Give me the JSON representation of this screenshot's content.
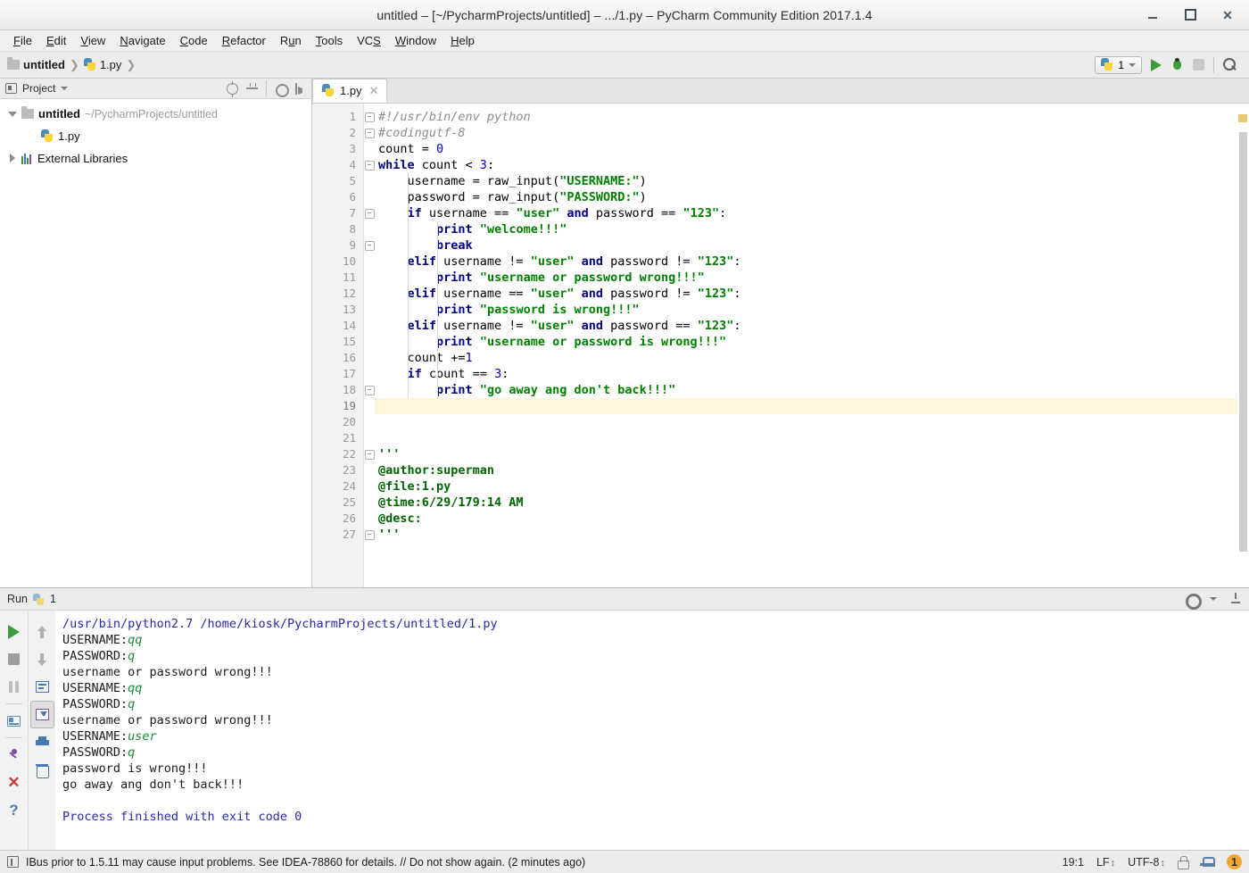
{
  "window": {
    "title": "untitled – [~/PycharmProjects/untitled] – .../1.py – PyCharm Community Edition 2017.1.4",
    "minimize_label": "",
    "maximize_label": "",
    "close_label": "✕"
  },
  "menubar": [
    {
      "pre": "",
      "mn": "F",
      "post": "ile"
    },
    {
      "pre": "",
      "mn": "E",
      "post": "dit"
    },
    {
      "pre": "",
      "mn": "V",
      "post": "iew"
    },
    {
      "pre": "",
      "mn": "N",
      "post": "avigate"
    },
    {
      "pre": "",
      "mn": "C",
      "post": "ode"
    },
    {
      "pre": "",
      "mn": "R",
      "post": "efactor"
    },
    {
      "pre": "R",
      "mn": "u",
      "post": "n"
    },
    {
      "pre": "",
      "mn": "T",
      "post": "ools"
    },
    {
      "pre": "VC",
      "mn": "S",
      "post": ""
    },
    {
      "pre": "",
      "mn": "W",
      "post": "indow"
    },
    {
      "pre": "",
      "mn": "H",
      "post": "elp"
    }
  ],
  "navbar": {
    "crumb_project": "untitled",
    "crumb_file": "1.py",
    "sep": "❯",
    "run_config": "1"
  },
  "project_panel": {
    "title": "Project",
    "root_name": "untitled",
    "root_path": "~/PycharmProjects/untitled",
    "file_name": "1.py",
    "libraries_label": "External Libraries"
  },
  "editor": {
    "tab_name": "1.py",
    "tab_close": "✕",
    "current_line": 19,
    "total_lines": 27,
    "lines": [
      {
        "n": 1,
        "fold": true,
        "tokens": [
          {
            "t": "#!/usr/bin/env python",
            "c": "c"
          }
        ]
      },
      {
        "n": 2,
        "fold": true,
        "tokens": [
          {
            "t": "#codingutf-8",
            "c": "c"
          }
        ]
      },
      {
        "n": 3,
        "fold": false,
        "tokens": [
          {
            "t": "count = ",
            "c": "p"
          },
          {
            "t": "0",
            "c": "n"
          }
        ]
      },
      {
        "n": 4,
        "fold": true,
        "tokens": [
          {
            "t": "while",
            "c": "k"
          },
          {
            "t": " count < ",
            "c": "p"
          },
          {
            "t": "3",
            "c": "n"
          },
          {
            "t": ":",
            "c": "p"
          }
        ]
      },
      {
        "n": 5,
        "fold": false,
        "tokens": [
          {
            "t": "    username = raw_input(",
            "c": "p"
          },
          {
            "t": "\"USERNAME:\"",
            "c": "s"
          },
          {
            "t": ")",
            "c": "p"
          }
        ]
      },
      {
        "n": 6,
        "fold": false,
        "tokens": [
          {
            "t": "    password = raw_input(",
            "c": "p"
          },
          {
            "t": "\"PASSWORD:\"",
            "c": "s"
          },
          {
            "t": ")",
            "c": "p"
          }
        ]
      },
      {
        "n": 7,
        "fold": true,
        "tokens": [
          {
            "t": "    ",
            "c": "p"
          },
          {
            "t": "if",
            "c": "k"
          },
          {
            "t": " username == ",
            "c": "p"
          },
          {
            "t": "\"user\"",
            "c": "s"
          },
          {
            "t": " ",
            "c": "p"
          },
          {
            "t": "and",
            "c": "k"
          },
          {
            "t": " password == ",
            "c": "p"
          },
          {
            "t": "\"123\"",
            "c": "s"
          },
          {
            "t": ":",
            "c": "p"
          }
        ]
      },
      {
        "n": 8,
        "fold": false,
        "tokens": [
          {
            "t": "        ",
            "c": "p"
          },
          {
            "t": "print",
            "c": "k"
          },
          {
            "t": " ",
            "c": "p"
          },
          {
            "t": "\"welcome!!!\"",
            "c": "s"
          }
        ]
      },
      {
        "n": 9,
        "fold": true,
        "tokens": [
          {
            "t": "        ",
            "c": "p"
          },
          {
            "t": "break",
            "c": "k"
          }
        ]
      },
      {
        "n": 10,
        "fold": false,
        "tokens": [
          {
            "t": "    ",
            "c": "p"
          },
          {
            "t": "elif",
            "c": "k"
          },
          {
            "t": " username != ",
            "c": "p"
          },
          {
            "t": "\"user\"",
            "c": "s"
          },
          {
            "t": " ",
            "c": "p"
          },
          {
            "t": "and",
            "c": "k"
          },
          {
            "t": " password != ",
            "c": "p"
          },
          {
            "t": "\"123\"",
            "c": "s"
          },
          {
            "t": ":",
            "c": "p"
          }
        ]
      },
      {
        "n": 11,
        "fold": false,
        "tokens": [
          {
            "t": "        ",
            "c": "p"
          },
          {
            "t": "print",
            "c": "k"
          },
          {
            "t": " ",
            "c": "p"
          },
          {
            "t": "\"username or password wrong!!!\"",
            "c": "s"
          }
        ]
      },
      {
        "n": 12,
        "fold": false,
        "tokens": [
          {
            "t": "    ",
            "c": "p"
          },
          {
            "t": "elif",
            "c": "k"
          },
          {
            "t": " username == ",
            "c": "p"
          },
          {
            "t": "\"user\"",
            "c": "s"
          },
          {
            "t": " ",
            "c": "p"
          },
          {
            "t": "and",
            "c": "k"
          },
          {
            "t": " password != ",
            "c": "p"
          },
          {
            "t": "\"123\"",
            "c": "s"
          },
          {
            "t": ":",
            "c": "p"
          }
        ]
      },
      {
        "n": 13,
        "fold": false,
        "tokens": [
          {
            "t": "        ",
            "c": "p"
          },
          {
            "t": "print",
            "c": "k"
          },
          {
            "t": " ",
            "c": "p"
          },
          {
            "t": "\"password is wrong!!!\"",
            "c": "s"
          }
        ]
      },
      {
        "n": 14,
        "fold": false,
        "tokens": [
          {
            "t": "    ",
            "c": "p"
          },
          {
            "t": "elif",
            "c": "k"
          },
          {
            "t": " username != ",
            "c": "p"
          },
          {
            "t": "\"user\"",
            "c": "s"
          },
          {
            "t": " ",
            "c": "p"
          },
          {
            "t": "and",
            "c": "k"
          },
          {
            "t": " password == ",
            "c": "p"
          },
          {
            "t": "\"123\"",
            "c": "s"
          },
          {
            "t": ":",
            "c": "p"
          }
        ]
      },
      {
        "n": 15,
        "fold": false,
        "tokens": [
          {
            "t": "        ",
            "c": "p"
          },
          {
            "t": "print",
            "c": "k"
          },
          {
            "t": " ",
            "c": "p"
          },
          {
            "t": "\"username or password is wrong!!!\"",
            "c": "s"
          }
        ]
      },
      {
        "n": 16,
        "fold": false,
        "tokens": [
          {
            "t": "    count +=",
            "c": "p"
          },
          {
            "t": "1",
            "c": "n"
          }
        ]
      },
      {
        "n": 17,
        "fold": false,
        "tokens": [
          {
            "t": "    ",
            "c": "p"
          },
          {
            "t": "if",
            "c": "k"
          },
          {
            "t": " count == ",
            "c": "p"
          },
          {
            "t": "3",
            "c": "n"
          },
          {
            "t": ":",
            "c": "p"
          }
        ]
      },
      {
        "n": 18,
        "fold": true,
        "tokens": [
          {
            "t": "        ",
            "c": "p"
          },
          {
            "t": "print",
            "c": "k"
          },
          {
            "t": " ",
            "c": "p"
          },
          {
            "t": "\"go away ang don't back!!!\"",
            "c": "s"
          }
        ]
      },
      {
        "n": 19,
        "fold": false,
        "tokens": []
      },
      {
        "n": 20,
        "fold": false,
        "tokens": []
      },
      {
        "n": 21,
        "fold": false,
        "tokens": []
      },
      {
        "n": 22,
        "fold": true,
        "tokens": [
          {
            "t": "'''",
            "c": "d"
          }
        ]
      },
      {
        "n": 23,
        "fold": false,
        "tokens": [
          {
            "t": "@author:superman",
            "c": "d"
          }
        ]
      },
      {
        "n": 24,
        "fold": false,
        "tokens": [
          {
            "t": "@file:1.py",
            "c": "d"
          }
        ]
      },
      {
        "n": 25,
        "fold": false,
        "tokens": [
          {
            "t": "@time:6/29/179:14 AM",
            "c": "d"
          }
        ]
      },
      {
        "n": 26,
        "fold": false,
        "tokens": [
          {
            "t": "@desc:",
            "c": "d"
          }
        ]
      },
      {
        "n": 27,
        "fold": true,
        "tokens": [
          {
            "t": "'''",
            "c": "d"
          }
        ]
      }
    ]
  },
  "run_panel": {
    "title": "Run",
    "config_name": "1",
    "console": [
      {
        "text": "/usr/bin/python2.7 /home/kiosk/PycharmProjects/untitled/1.py",
        "c": "cmd"
      },
      {
        "segments": [
          {
            "t": "USERNAME:",
            "c": "out"
          },
          {
            "t": "qq",
            "c": "inp"
          }
        ]
      },
      {
        "segments": [
          {
            "t": "PASSWORD:",
            "c": "out"
          },
          {
            "t": "q",
            "c": "inp"
          }
        ]
      },
      {
        "text": "username or password wrong!!!",
        "c": "out"
      },
      {
        "segments": [
          {
            "t": "USERNAME:",
            "c": "out"
          },
          {
            "t": "qq",
            "c": "inp"
          }
        ]
      },
      {
        "segments": [
          {
            "t": "PASSWORD:",
            "c": "out"
          },
          {
            "t": "q",
            "c": "inp"
          }
        ]
      },
      {
        "text": "username or password wrong!!!",
        "c": "out"
      },
      {
        "segments": [
          {
            "t": "USERNAME:",
            "c": "out"
          },
          {
            "t": "user",
            "c": "inp"
          }
        ]
      },
      {
        "segments": [
          {
            "t": "PASSWORD:",
            "c": "out"
          },
          {
            "t": "q",
            "c": "inp"
          }
        ]
      },
      {
        "text": "password is wrong!!!",
        "c": "out"
      },
      {
        "text": "go away ang don't back!!!",
        "c": "out"
      },
      {
        "text": "",
        "c": "out"
      },
      {
        "text": "Process finished with exit code 0",
        "c": "fin"
      }
    ]
  },
  "statusbar": {
    "message": "IBus prior to 1.5.11 may cause input problems. See IDEA-78860 for details. // Do not show again. (2 minutes ago)",
    "caret_position": "19:1",
    "line_separator": "LF",
    "encoding": "UTF-8",
    "notification_count": "1"
  },
  "colors": {
    "keyword": "#000080",
    "string": "#008000",
    "number": "#0000c0",
    "comment": "#8c8c8c",
    "docstring": "#006400",
    "current_line_bg": "#fdf6dd",
    "accent_run": "#3d9c3d",
    "badge": "#f0a732"
  }
}
